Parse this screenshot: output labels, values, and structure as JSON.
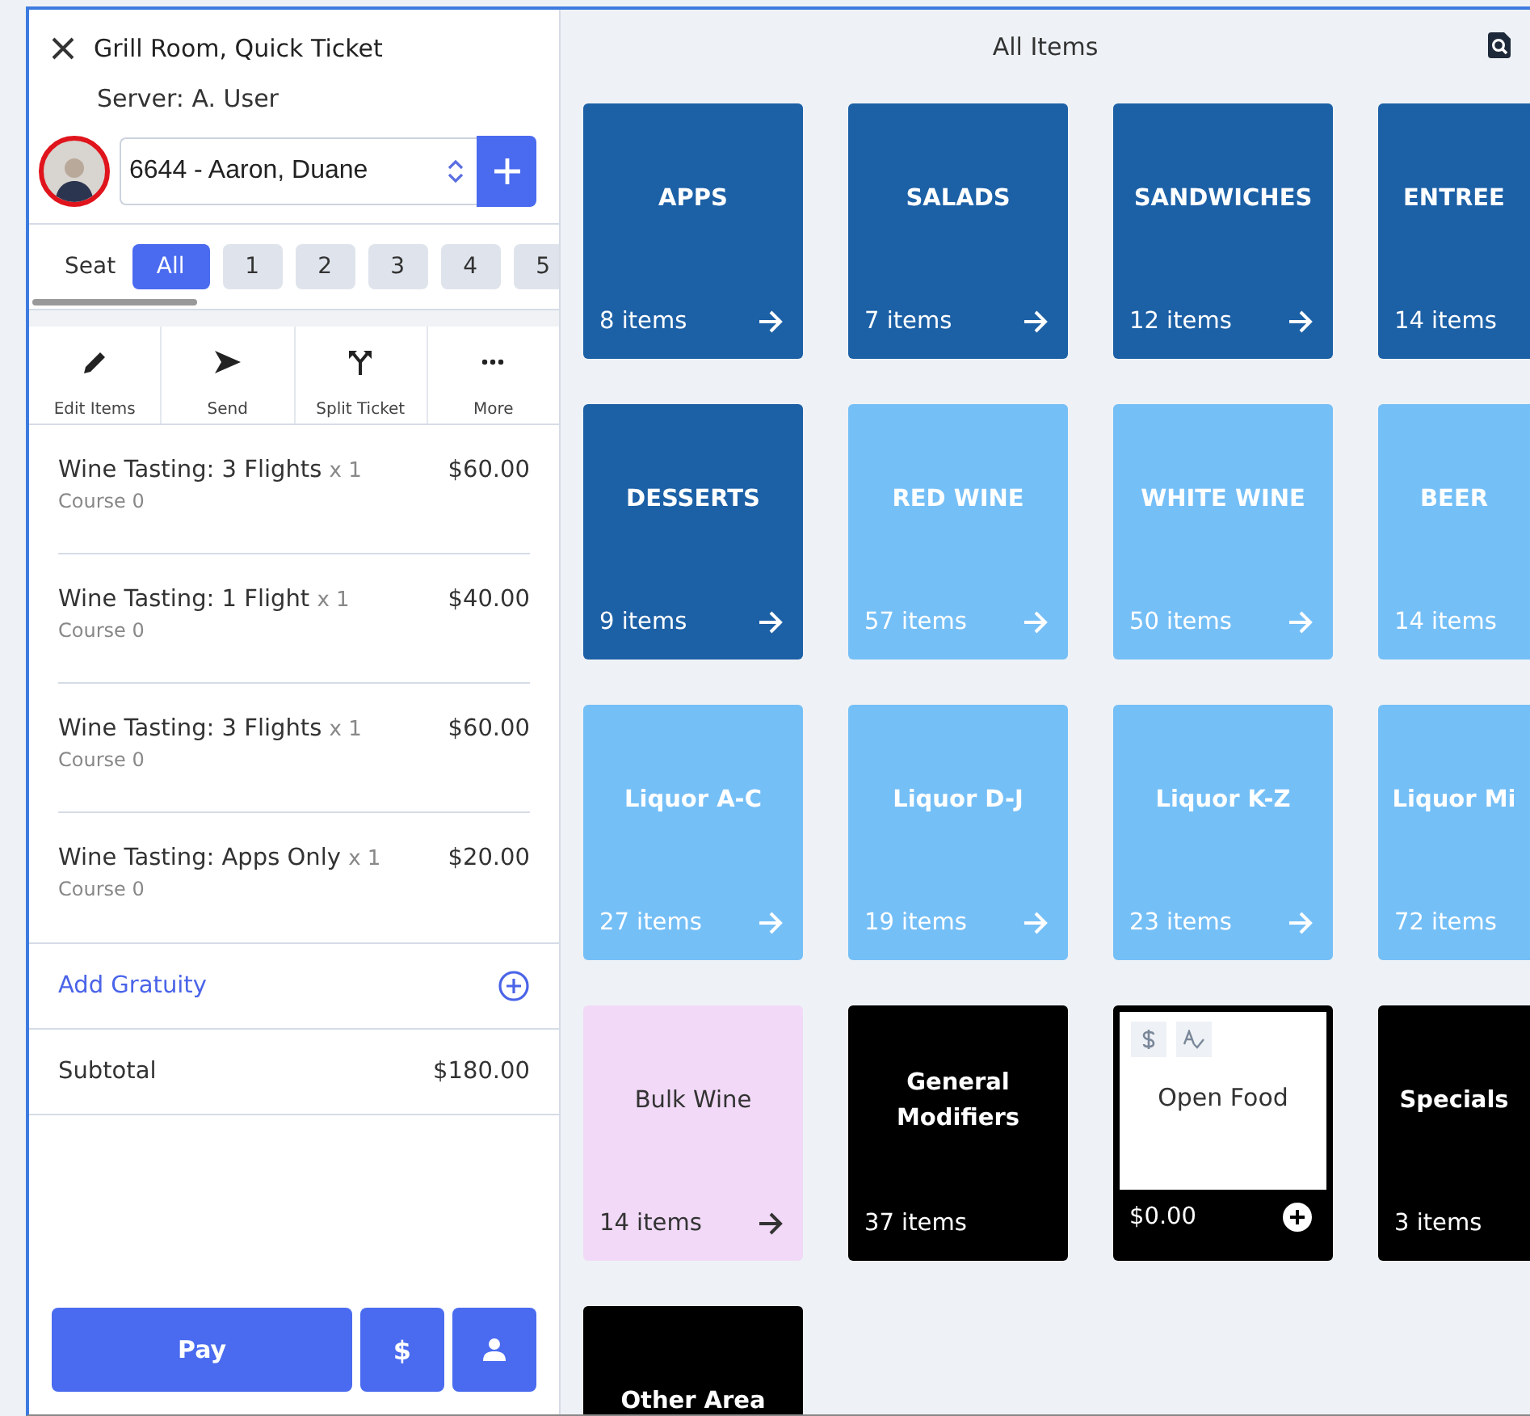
{
  "ticket": {
    "title": "Grill Room, Quick Ticket",
    "server": "Server: A. User",
    "customer": {
      "value": "6644 - Aaron, Duane"
    },
    "seat_label": "Seat",
    "seats": [
      {
        "label": "All",
        "selected": true
      },
      {
        "label": "1",
        "selected": false
      },
      {
        "label": "2",
        "selected": false
      },
      {
        "label": "3",
        "selected": false
      },
      {
        "label": "4",
        "selected": false
      },
      {
        "label": "5",
        "selected": false
      }
    ],
    "actions": [
      {
        "kind": "edit",
        "label": "Edit Items"
      },
      {
        "kind": "send",
        "label": "Send"
      },
      {
        "kind": "split",
        "label": "Split Ticket"
      },
      {
        "kind": "more",
        "label": "More"
      }
    ],
    "lines": [
      {
        "name": "Wine Tasting: 3 Flights",
        "qty": "x 1",
        "price": "$60.00",
        "course": "Course 0"
      },
      {
        "name": "Wine Tasting: 1 Flight",
        "qty": "x 1",
        "price": "$40.00",
        "course": "Course 0"
      },
      {
        "name": "Wine Tasting: 3 Flights",
        "qty": "x 1",
        "price": "$60.00",
        "course": "Course 0"
      },
      {
        "name": "Wine Tasting: Apps Only",
        "qty": "x 1",
        "price": "$20.00",
        "course": "Course 0"
      }
    ],
    "gratuity": "Add Gratuity",
    "subtotal": {
      "label": "Subtotal",
      "value": "$180.00"
    },
    "buttons": [
      {
        "kind": "text",
        "label": "Pay"
      },
      {
        "kind": "text",
        "label": "$"
      },
      {
        "kind": "person"
      }
    ]
  },
  "menu": {
    "title": "All Items",
    "tiles": [
      {
        "kind": "category",
        "name": "APPS",
        "count": "8 items",
        "color": "#1c60a6"
      },
      {
        "kind": "category",
        "name": "SALADS",
        "count": "7 items",
        "color": "#1c60a6"
      },
      {
        "kind": "category",
        "name": "SANDWICHES",
        "count": "12 items",
        "color": "#1c60a6"
      },
      {
        "kind": "category",
        "name": "ENTREE",
        "count": "14 items",
        "color": "#1c60a6"
      },
      {
        "kind": "category",
        "name": "DESSERTS",
        "count": "9 items",
        "color": "#1c60a6"
      },
      {
        "kind": "category",
        "name": "RED WINE",
        "count": "57 items",
        "color": "#75bff7"
      },
      {
        "kind": "category",
        "name": "WHITE WINE",
        "count": "50 items",
        "color": "#75bff7"
      },
      {
        "kind": "category",
        "name": "BEER",
        "count": "14 items",
        "color": "#75bff7"
      },
      {
        "kind": "category",
        "name": "Liquor A-C",
        "count": "27 items",
        "color": "#75bff7"
      },
      {
        "kind": "category",
        "name": "Liquor D-J",
        "count": "19 items",
        "color": "#75bff7"
      },
      {
        "kind": "category",
        "name": "Liquor K-Z",
        "count": "23 items",
        "color": "#75bff7"
      },
      {
        "kind": "category",
        "name": "Liquor Mi",
        "count": "72 items",
        "color": "#75bff7"
      },
      {
        "kind": "category",
        "name": "Bulk Wine",
        "count": "14 items",
        "color": "#f1d9f7"
      },
      {
        "kind": "category",
        "name": "General Modifiers",
        "count": "37 items",
        "color": "#000000"
      },
      {
        "kind": "open",
        "name": "Open Food",
        "price": "$0.00",
        "color": "#000000"
      },
      {
        "kind": "category",
        "name": "Specials",
        "count": "3 items",
        "color": "#000000"
      },
      {
        "kind": "category",
        "name": "Other Area",
        "color": "#000000"
      }
    ]
  }
}
